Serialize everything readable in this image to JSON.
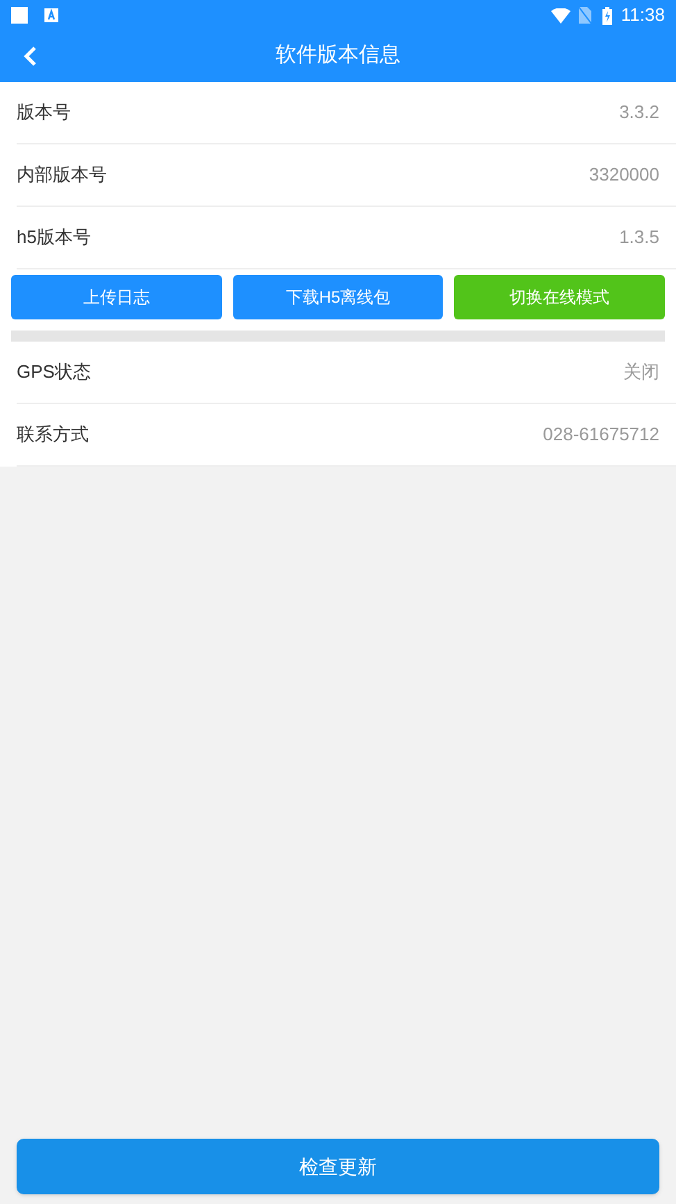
{
  "status_bar": {
    "time": "11:38"
  },
  "header": {
    "title": "软件版本信息"
  },
  "info_rows": [
    {
      "label": "版本号",
      "value": "3.3.2"
    },
    {
      "label": "内部版本号",
      "value": "3320000"
    },
    {
      "label": "h5版本号",
      "value": "1.3.5"
    }
  ],
  "buttons": [
    {
      "label": "上传日志",
      "color": "#1e90ff"
    },
    {
      "label": "下载H5离线包",
      "color": "#1e90ff"
    },
    {
      "label": "切换在线模式",
      "color": "#52c41a"
    }
  ],
  "settings_rows": [
    {
      "label": "GPS状态",
      "value": "关闭"
    },
    {
      "label": "联系方式",
      "value": "028-61675712"
    }
  ],
  "footer_button": {
    "label": "检查更新"
  }
}
